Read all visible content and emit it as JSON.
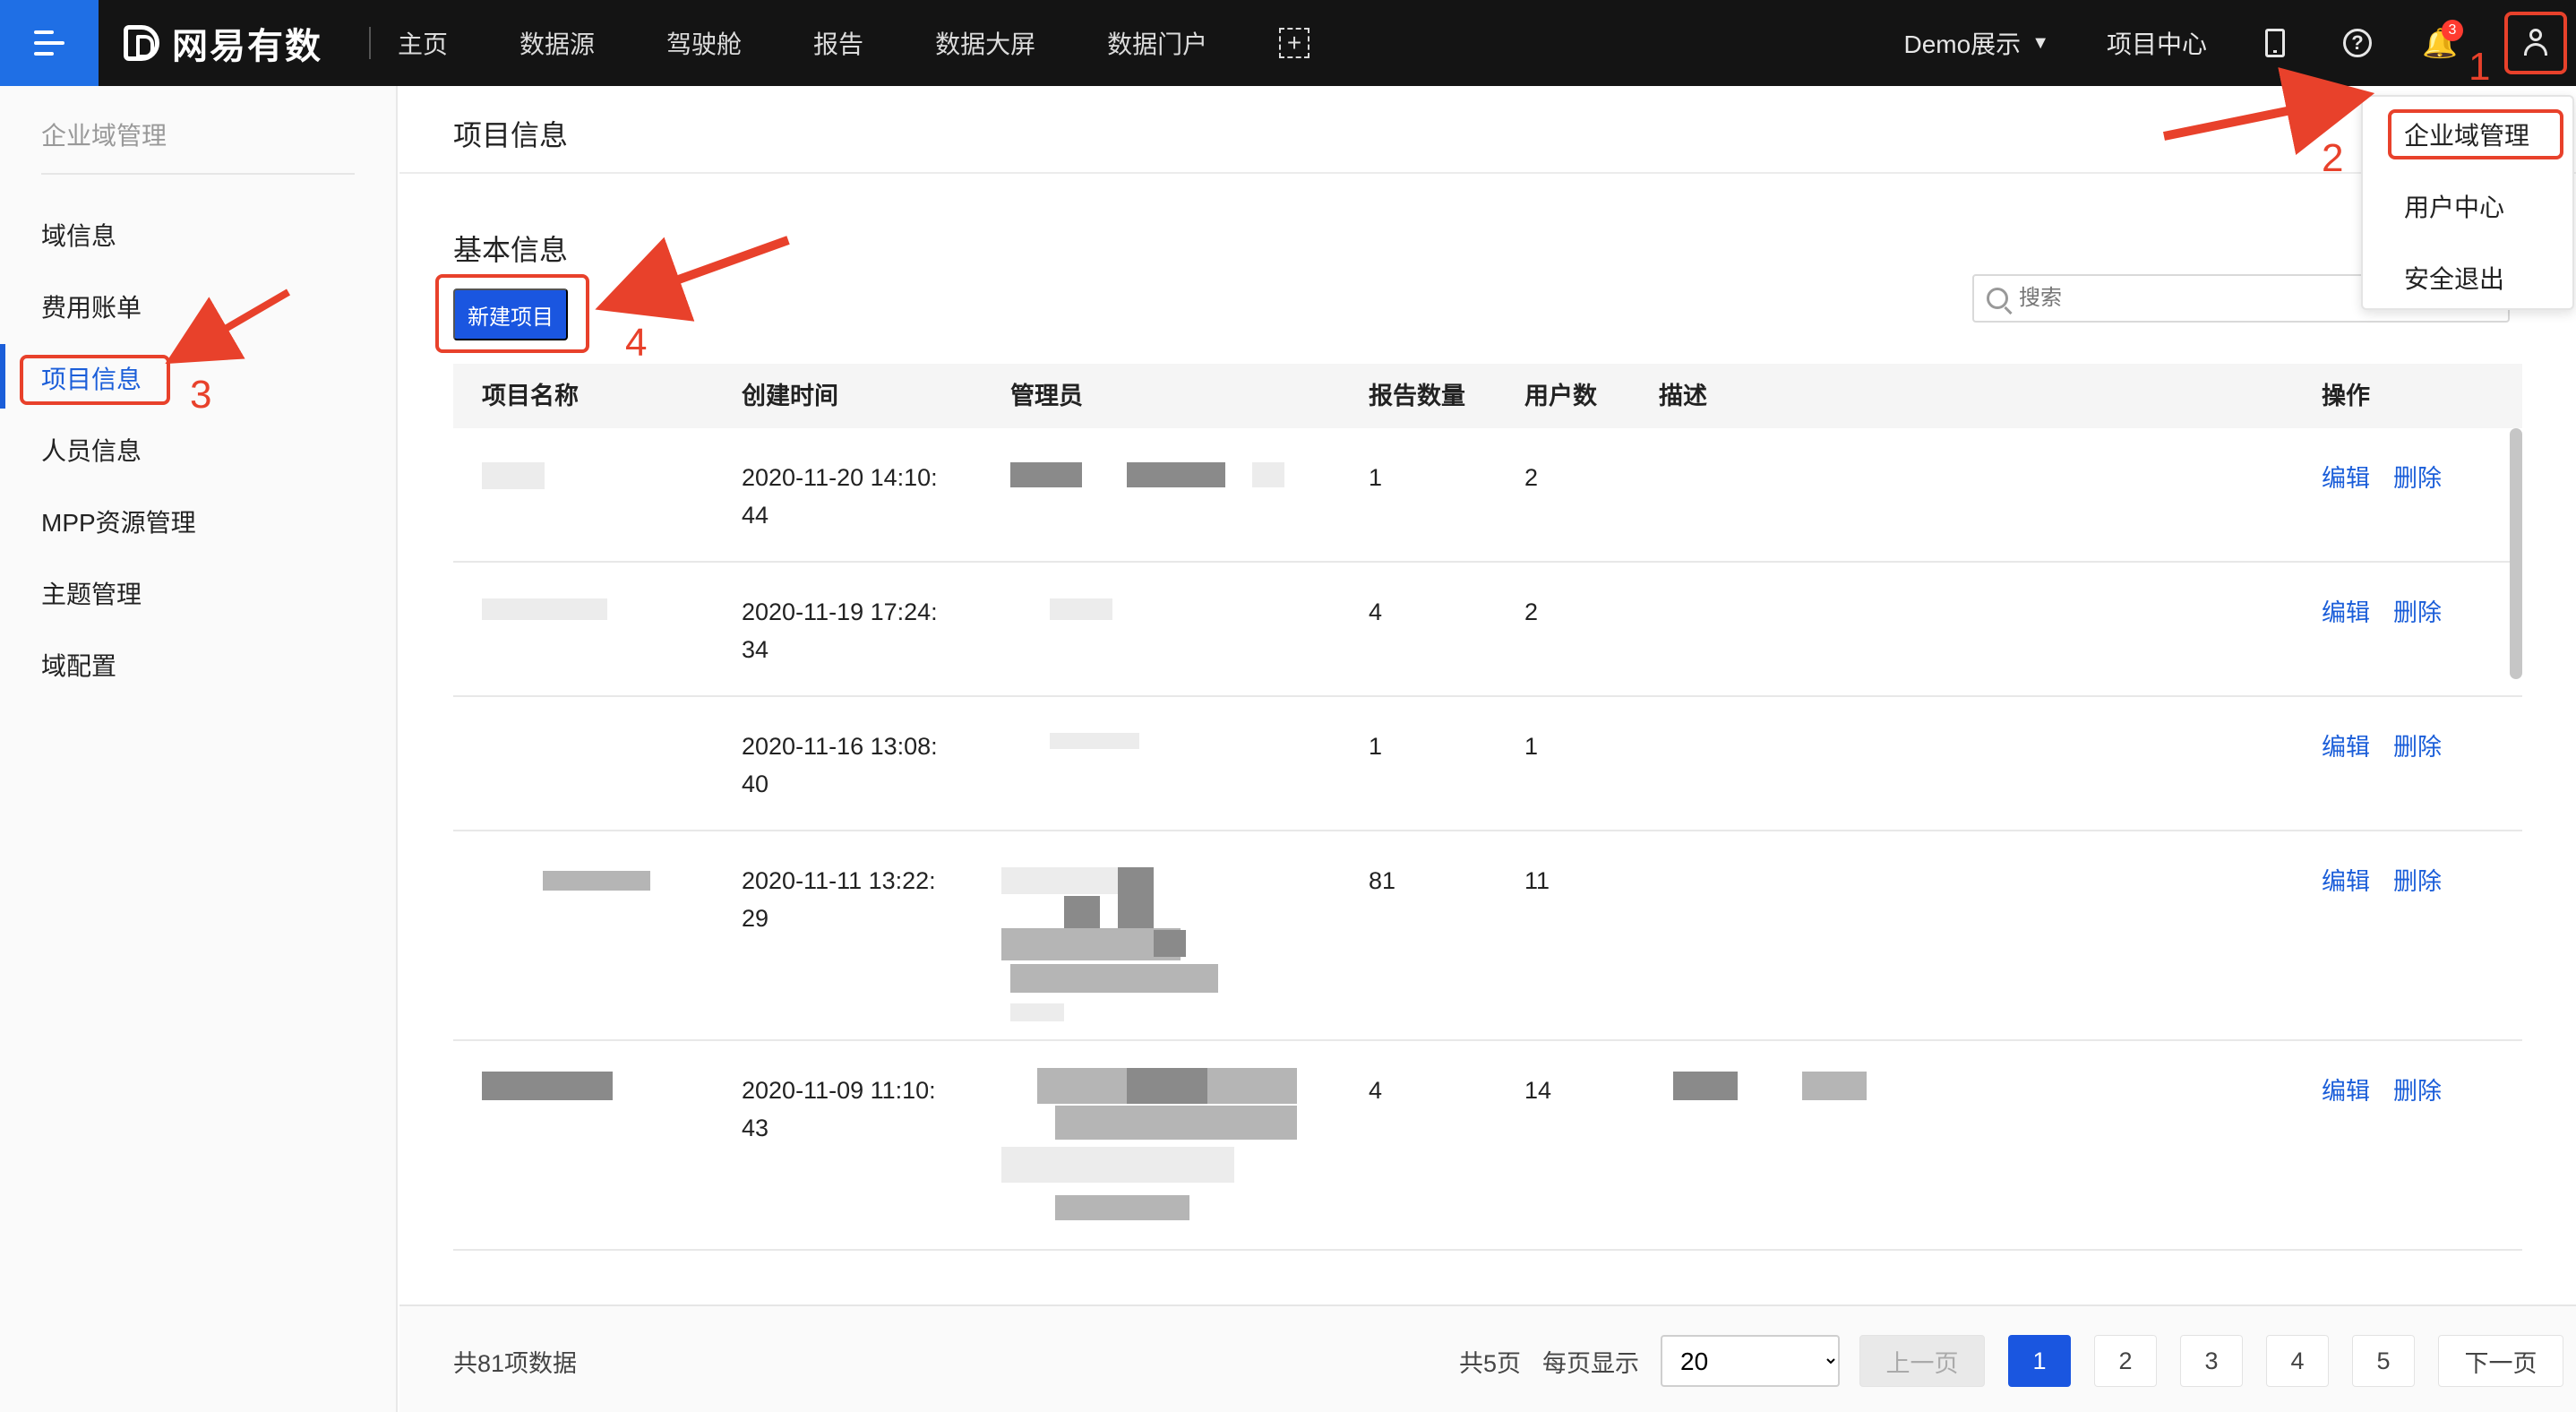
{
  "app": {
    "brand": "网易有数",
    "nav": [
      "主页",
      "数据源",
      "驾驶舱",
      "报告",
      "数据大屏",
      "数据门户"
    ],
    "add_symbol": "+",
    "workspace": "Demo展示",
    "caret": "▼",
    "project_center": "项目中心",
    "help_symbol": "?",
    "bell_symbol": "🔔",
    "notification_count": "3"
  },
  "sidebar": {
    "title": "企业域管理",
    "items": [
      "域信息",
      "费用账单",
      "项目信息",
      "人员信息",
      "MPP资源管理",
      "主题管理",
      "域配置"
    ],
    "active_index": 2
  },
  "main": {
    "page_title": "项目信息",
    "section_title": "基本信息",
    "new_button": "新建项目",
    "search_placeholder": "搜索"
  },
  "table": {
    "headers": [
      "项目名称",
      "创建时间",
      "管理员",
      "报告数量",
      "用户数",
      "描述",
      "操作"
    ],
    "rows": [
      {
        "time_1": "2020-11-20 14:10:",
        "time_2": "44",
        "reports": "1",
        "users": "2"
      },
      {
        "time_1": "2020-11-19 17:24:",
        "time_2": "34",
        "reports": "4",
        "users": "2"
      },
      {
        "time_1": "2020-11-16 13:08:",
        "time_2": "40",
        "reports": "1",
        "users": "1"
      },
      {
        "time_1": "2020-11-11 13:22:",
        "time_2": "29",
        "reports": "81",
        "users": "11"
      },
      {
        "time_1": "2020-11-09 11:10:",
        "time_2": "43",
        "reports": "4",
        "users": "14"
      }
    ],
    "edit_label": "编辑",
    "delete_label": "删除"
  },
  "footer": {
    "total": "共81项数据",
    "pages_total": "共5页",
    "per_page_label": "每页显示",
    "page_size": "20",
    "prev": "上一页",
    "pages": [
      "1",
      "2",
      "3",
      "4",
      "5"
    ],
    "current_page": "1",
    "next": "下一页"
  },
  "user_menu": {
    "items": [
      "企业域管理",
      "用户中心",
      "安全退出"
    ]
  },
  "annotations": {
    "steps": [
      "1",
      "2",
      "3",
      "4"
    ],
    "color": "#e8412b"
  },
  "colors": {
    "primary": "#1a56e0",
    "link": "#1b5ed9",
    "topbar": "#141414",
    "menu_button": "#1f6fe5"
  }
}
